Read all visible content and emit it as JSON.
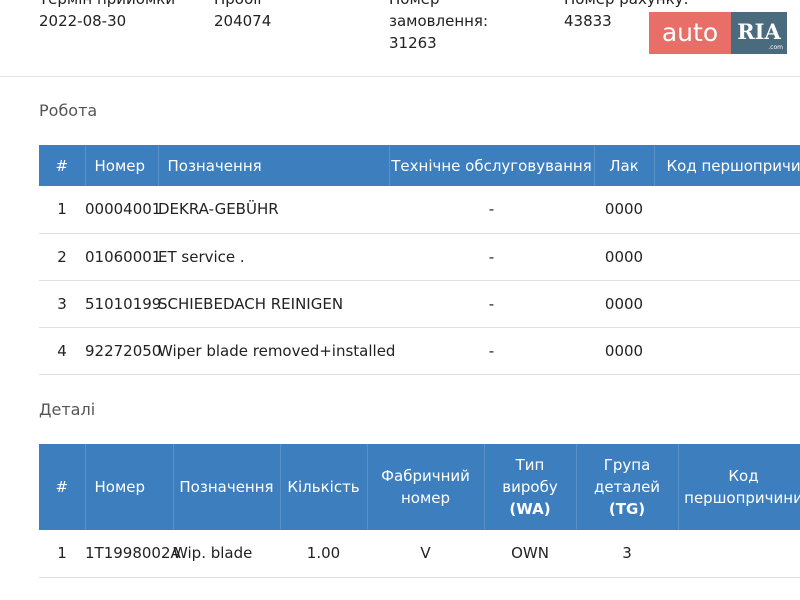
{
  "header": {
    "col1_label": "Термін прийомки",
    "col1_value": "2022-08-30",
    "col2_label": "Пробіг",
    "col2_value": "204074",
    "col3_label_line1": "Номер",
    "col3_label_line2": "замовлення:",
    "col3_value": "31263",
    "col4_label": "Номер рахунку:",
    "col4_value": "43833"
  },
  "logo": {
    "auto": "auto",
    "ria": "RIA",
    "com": ".com"
  },
  "works": {
    "title": "Робота",
    "headers": [
      "#",
      "Номер",
      "Позначення",
      "Технічне обслуговування",
      "Лак",
      "Код першопричини"
    ],
    "rows": [
      {
        "n": "1",
        "number": "00004001",
        "name": "DEKRA-GEBÜHR",
        "service": "-",
        "lac": "0000"
      },
      {
        "n": "2",
        "number": "01060001",
        "name": "ET service .",
        "service": "-",
        "lac": "0000"
      },
      {
        "n": "3",
        "number": "51010199",
        "name": "SCHIEBEDACH REINIGEN",
        "service": "-",
        "lac": "0000"
      },
      {
        "n": "4",
        "number": "92272050",
        "name": "Wiper blade removed+installed",
        "service": "-",
        "lac": "0000"
      }
    ]
  },
  "parts": {
    "title": "Деталі",
    "headers": {
      "n": "#",
      "number": "Номер",
      "name": "Позначення",
      "qty": "Кількість",
      "factory_line1": "Фабричний",
      "factory_line2": "номер",
      "type_line1": "Тип",
      "type_line2": "виробу",
      "type_line3": "(WA)",
      "group_line1": "Група",
      "group_line2": "деталей",
      "group_line3": "(TG)",
      "cause_line1": "Код",
      "cause_line2": "першопричини"
    },
    "rows": [
      {
        "n": "1",
        "number": "1T1998002A",
        "name": "Wip. blade",
        "qty": "1.00",
        "factory": "V",
        "type": "OWN",
        "group": "3"
      }
    ]
  }
}
